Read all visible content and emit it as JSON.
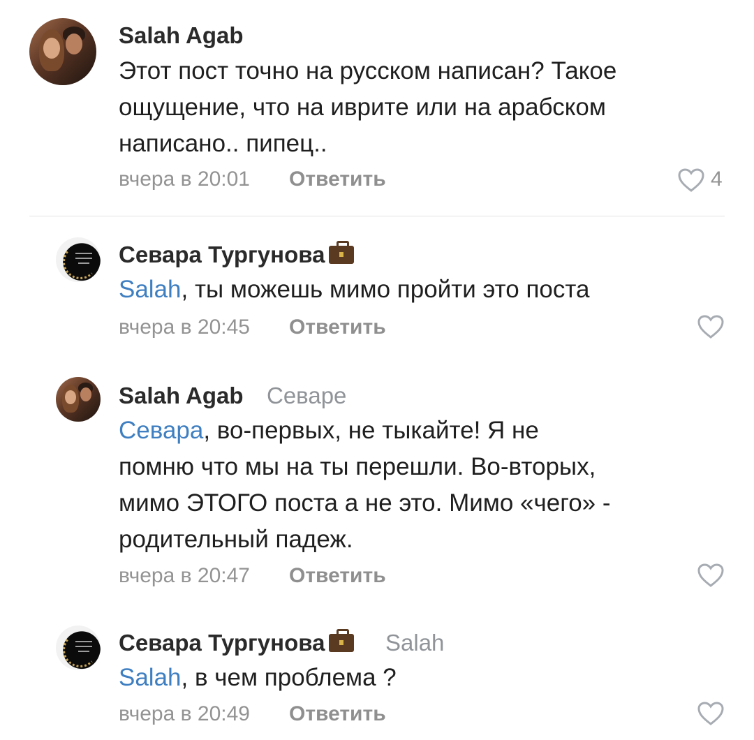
{
  "colors": {
    "mention": "#3f7fc1",
    "meta": "#939393",
    "icon": "#a7acb3"
  },
  "comments": [
    {
      "author": "Salah Agab",
      "avatar": "couple-photo-avatar",
      "text_lines": [
        "Этот пост точно на русском написан? Такое",
        "ощущение, что на иврите или на арабском",
        "написано.. пипец.."
      ],
      "time": "вчера в 20:01",
      "reply_label": "Ответить",
      "likes": "4"
    },
    {
      "author": "Севара Тургунова",
      "badge_icon": "briefcase-icon",
      "mention": "Salah",
      "text_rest": ", ты можешь мимо пройти это поста",
      "time": "вчера в 20:45",
      "reply_label": "Ответить"
    },
    {
      "author": "Salah Agab",
      "reply_to": "Севаре",
      "mention": "Севара",
      "text_first_rest": ", во-первых, не тыкайте! Я не",
      "text_lines": [
        "помню что мы на ты перешли. Во-вторых,",
        "мимо ЭТОГО поста а не это. Мимо «чего» -",
        "родительный падеж."
      ],
      "time": "вчера в 20:47",
      "reply_label": "Ответить"
    },
    {
      "author": "Севара Тургунова",
      "badge_icon": "briefcase-icon",
      "reply_to": "Salah",
      "mention": "Salah",
      "text_rest": ", в чем проблема ?",
      "time": "вчера в 20:49",
      "reply_label": "Ответить"
    }
  ]
}
